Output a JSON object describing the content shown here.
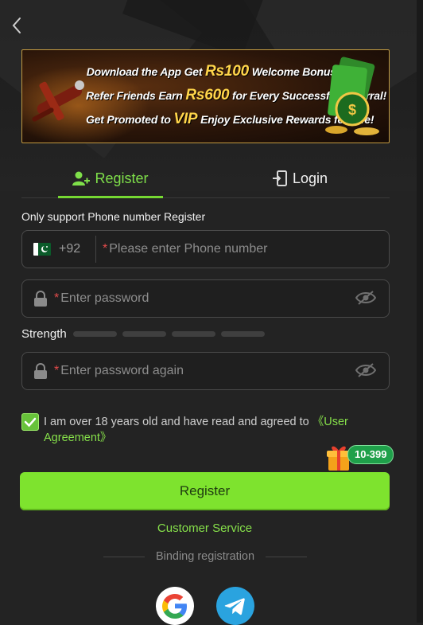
{
  "nav": {
    "back_icon": "chevron-left-icon"
  },
  "banner": {
    "line1_a": "Download the App  Get ",
    "line1_hl": "Rs100",
    "line1_b": " Welcome Bonus!",
    "line2_a": "Refer Friends  Earn ",
    "line2_hl": "Rs600",
    "line2_b": " for Every Successful Referral!",
    "line3_a": "Get Promoted to ",
    "line3_hl": "VIP",
    "line3_b": "  Enjoy Exclusive Rewards for Life!"
  },
  "tabs": {
    "register_label": "Register",
    "login_label": "Login",
    "active": "register"
  },
  "form": {
    "hint": "Only support Phone number Register",
    "phone": {
      "country_code": "+92",
      "flag": "pakistan-flag",
      "required_mark": "*",
      "placeholder": "Please enter Phone number"
    },
    "password": {
      "required_mark": "*",
      "placeholder": "Enter password"
    },
    "strength": {
      "label": "Strength",
      "level": 0,
      "segments": 4
    },
    "password_again": {
      "required_mark": "*",
      "placeholder": "Enter password again"
    },
    "agreement": {
      "checked": true,
      "text": "I am over 18 years old and have read and agreed to ",
      "link_part1": "《User",
      "link_part2": "Agreement》"
    },
    "gift_badge": "10-399",
    "submit_label": "Register"
  },
  "footer": {
    "customer_service": "Customer Service",
    "binding_label": "Binding registration",
    "social": [
      "google-icon",
      "telegram-icon"
    ]
  },
  "colors": {
    "accent": "#7ee32e",
    "link": "#86e04a",
    "background": "#232323",
    "required": "#e34b4b"
  }
}
